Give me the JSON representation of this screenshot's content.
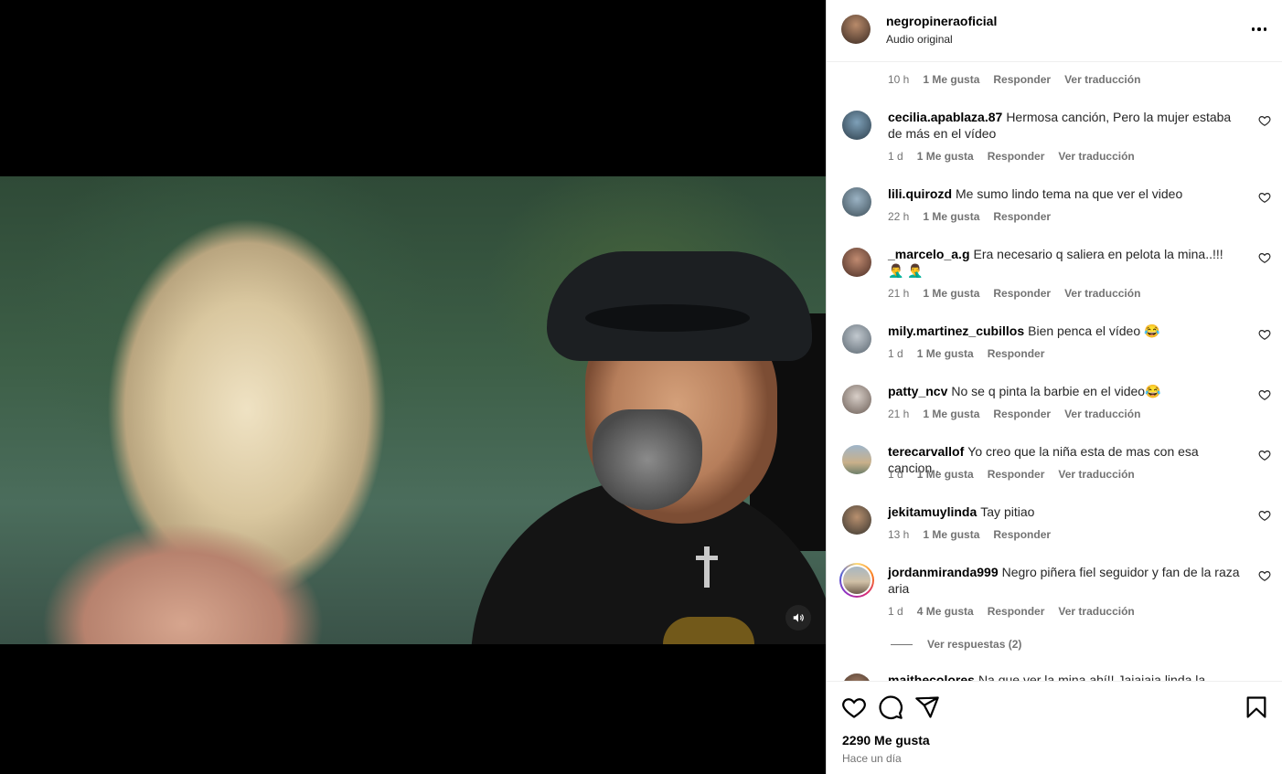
{
  "post": {
    "username": "negropineraoficial",
    "audio": "Audio original",
    "likes": "2290 Me gusta",
    "posted": "Hace un día"
  },
  "comments_partial": {
    "time": "10 h",
    "likes": "1 Me gusta",
    "reply": "Responder",
    "translate": "Ver traducción"
  },
  "comments": [
    {
      "username": "cecilia.apablaza.87",
      "text": "Hermosa canción, Pero la mujer estaba de más en el vídeo",
      "time": "1 d",
      "likes": "1 Me gusta",
      "reply": "Responder",
      "translate": "Ver traducción"
    },
    {
      "username": "lili.quirozd",
      "text": "Me sumo lindo tema na que ver el video",
      "time": "22 h",
      "likes": "1 Me gusta",
      "reply": "Responder",
      "translate": ""
    },
    {
      "username": "_marcelo_a.g",
      "text": "Era necesario q saliera en pelota la mina..!!! 🤦‍♂️ 🤦‍♂️",
      "time": "21 h",
      "likes": "1 Me gusta",
      "reply": "Responder",
      "translate": "Ver traducción"
    },
    {
      "username": "mily.martinez_cubillos",
      "text": "Bien penca el vídeo 😂",
      "time": "1 d",
      "likes": "1 Me gusta",
      "reply": "Responder",
      "translate": ""
    },
    {
      "username": "patty_ncv",
      "text": "No se q pinta la barbie en el video😂",
      "time": "21 h",
      "likes": "1 Me gusta",
      "reply": "Responder",
      "translate": "Ver traducción"
    },
    {
      "username": "terecarvallof",
      "text": "Yo creo que la niña esta de mas con esa cancion .",
      "time": "1 d",
      "likes": "1 Me gusta",
      "reply": "Responder",
      "translate": "Ver traducción"
    },
    {
      "username": "jekitamuylinda",
      "text": "Tay pitiao",
      "time": "13 h",
      "likes": "1 Me gusta",
      "reply": "Responder",
      "translate": ""
    },
    {
      "username": "jordanmiranda999",
      "text": "Negro piñera fiel seguidor y fan de la raza aria",
      "time": "1 d",
      "likes": "4 Me gusta",
      "reply": "Responder",
      "translate": "Ver traducción"
    }
  ],
  "view_replies": "Ver respuestas (2)",
  "last_comment": {
    "username": "maithecolores",
    "text": "Na que ver la mina ahí!! Jajajaja linda la canción"
  }
}
